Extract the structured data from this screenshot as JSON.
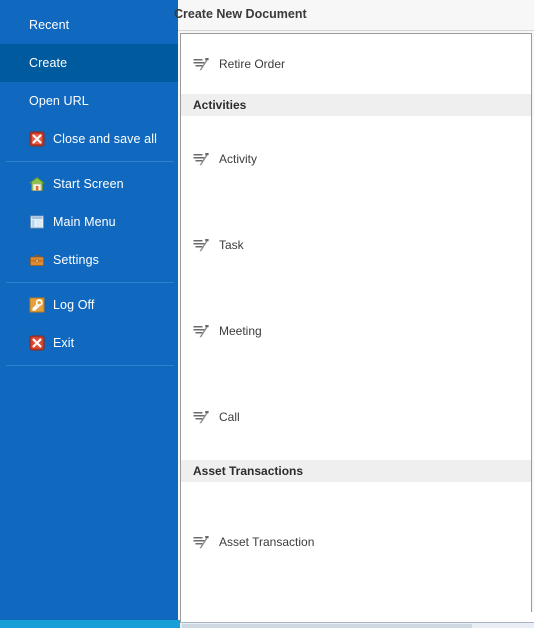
{
  "sidebar": {
    "background_color": "#1069be",
    "selected_color": "#005a9e",
    "items": [
      {
        "label": "Recent",
        "icon": "none",
        "selected": false
      },
      {
        "label": "Create",
        "icon": "none",
        "selected": true
      },
      {
        "label": "Open URL",
        "icon": "none",
        "selected": false
      },
      {
        "label": "Close and save all",
        "icon": "close-save-icon",
        "selected": false
      },
      {
        "label": "Start Screen",
        "icon": "home-icon",
        "selected": false
      },
      {
        "label": "Main Menu",
        "icon": "main-menu-icon",
        "selected": false
      },
      {
        "label": "Settings",
        "icon": "briefcase-icon",
        "selected": false
      },
      {
        "label": "Log Off",
        "icon": "key-icon",
        "selected": false
      },
      {
        "label": "Exit",
        "icon": "exit-icon",
        "selected": false
      }
    ]
  },
  "content": {
    "header_title": "Create New Document",
    "sections": [
      {
        "group_header": null,
        "items": [
          {
            "label": "Retire Order",
            "icon": "new-document-icon"
          }
        ]
      },
      {
        "group_header": "Activities",
        "items": [
          {
            "label": "Activity",
            "icon": "new-document-icon"
          },
          {
            "label": "Task",
            "icon": "new-document-icon"
          },
          {
            "label": "Meeting",
            "icon": "new-document-icon"
          },
          {
            "label": "Call",
            "icon": "new-document-icon"
          }
        ]
      },
      {
        "group_header": "Asset Transactions",
        "items": [
          {
            "label": "Asset Transaction",
            "icon": "new-document-icon"
          }
        ]
      }
    ]
  },
  "colors": {
    "accent_blue": "#1069be",
    "selected_blue": "#005a9e",
    "bottom_strip_blue": "#17a0d8",
    "group_header_gray": "#efefef",
    "panel_border": "#9a9a9a"
  }
}
